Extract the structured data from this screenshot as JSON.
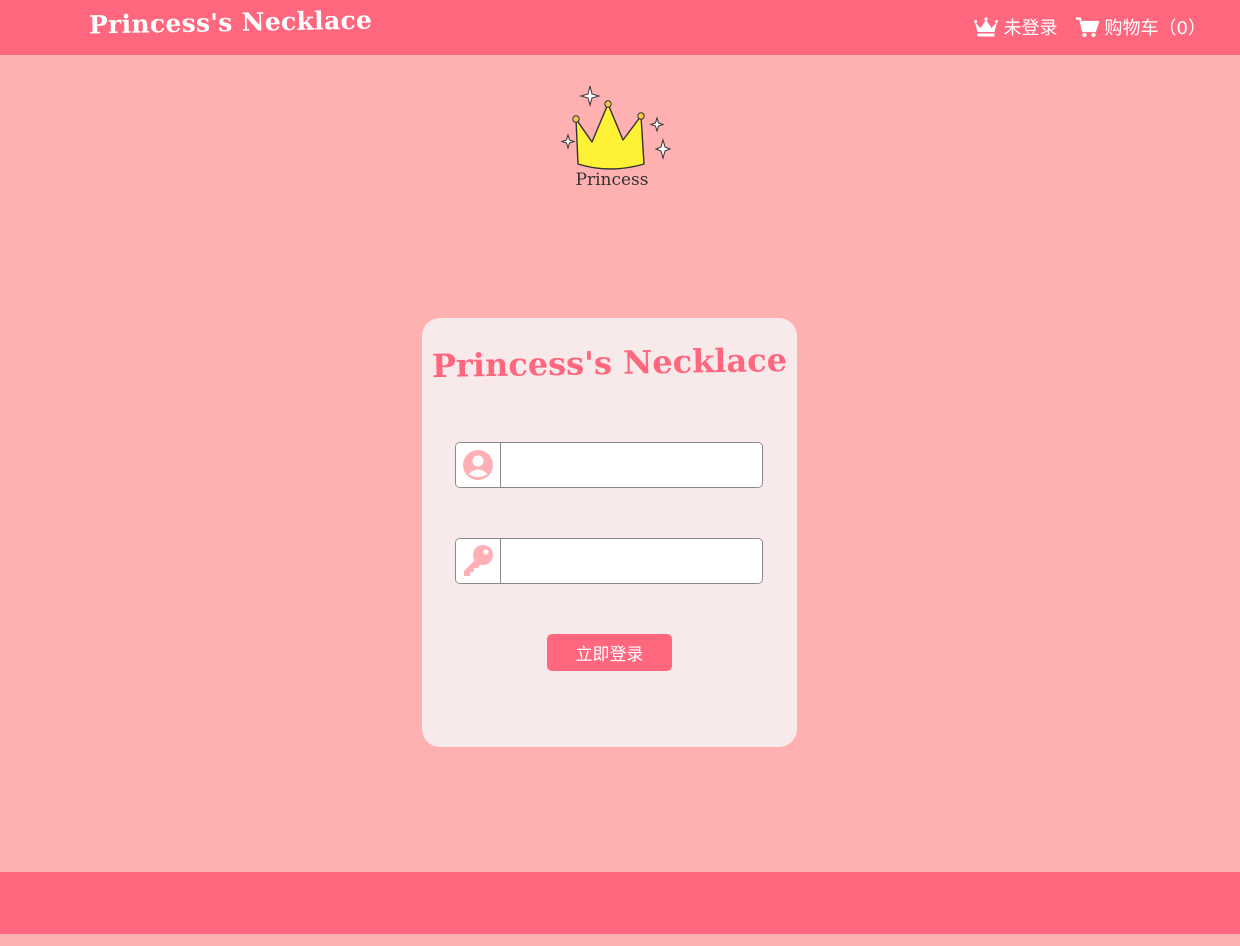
{
  "header": {
    "brand": "Princess's Necklace",
    "login_status": "未登录",
    "cart_label": "购物车（0）",
    "login_icon": "crown-icon",
    "cart_icon": "cart-icon"
  },
  "logo": {
    "caption": "Princess",
    "icon": "crown-logo"
  },
  "login": {
    "title": "Princess's Necklace",
    "username_value": "",
    "password_value": "",
    "username_icon": "user-circle-icon",
    "password_icon": "key-icon",
    "submit_label": "立即登录"
  },
  "colors": {
    "primary": "#ff677e",
    "background": "#ffb0b0",
    "card": "#f8eaea",
    "icon": "#ffb0b6"
  }
}
